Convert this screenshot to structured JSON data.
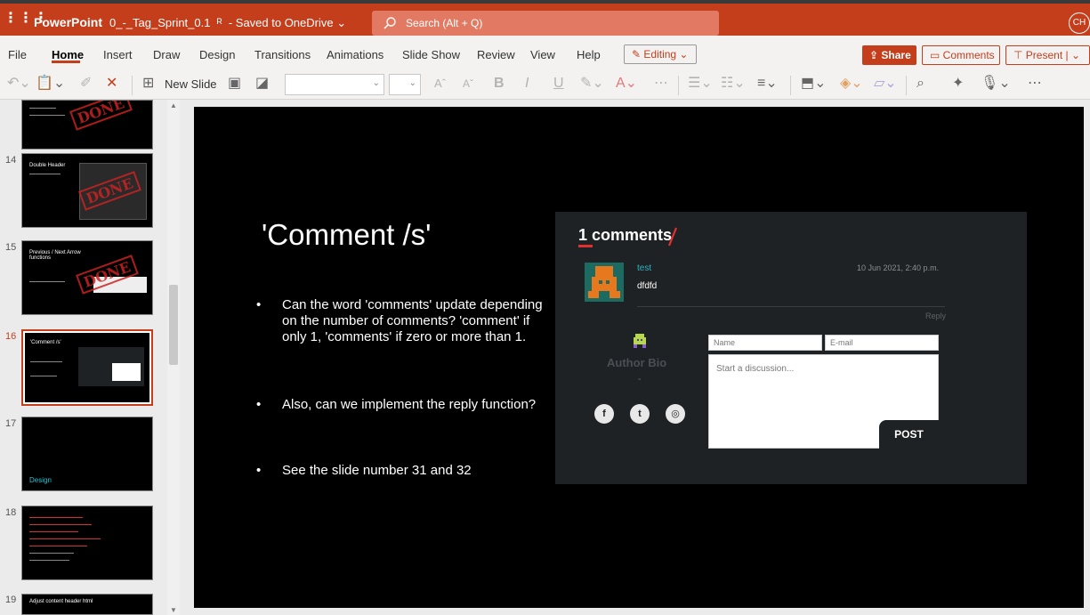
{
  "app": {
    "name": "PowerPoint",
    "document_title": "0_-_Tag_Sprint_0.1",
    "save_status": "- Saved to OneDrive",
    "search_placeholder": "Search (Alt + Q)",
    "user_initials": "CH"
  },
  "ribbon": {
    "tabs": [
      "File",
      "Home",
      "Insert",
      "Draw",
      "Design",
      "Transitions",
      "Animations",
      "Slide Show",
      "Review",
      "View",
      "Help"
    ],
    "active_tab": "Home",
    "editing_label": "Editing",
    "share_label": "Share",
    "comments_label": "Comments",
    "present_label": "Present",
    "new_slide_label": "New Slide"
  },
  "thumbnails": [
    {
      "num": "",
      "title": "",
      "stamp": "DONE"
    },
    {
      "num": "14",
      "title": "Double Header",
      "stamp": "DONE"
    },
    {
      "num": "15",
      "title": "Previous / Next Arrow functions",
      "stamp": "DONE"
    },
    {
      "num": "16",
      "title": "'Comment /s'",
      "selected": true
    },
    {
      "num": "17",
      "title": "Design"
    },
    {
      "num": "18",
      "title": ""
    },
    {
      "num": "19",
      "title": "Adjust content header html"
    }
  ],
  "slide": {
    "title": "'Comment /s'",
    "bullets": [
      "Can the word 'comments' update depending on the number of comments? 'comment' if only 1, 'comments' if zero or more than 1.",
      "Also, can we implement the reply function?",
      "See the slide number 31 and 32"
    ],
    "widget": {
      "count_label": "1 comments",
      "comment": {
        "user": "test",
        "text": "dfdfd",
        "date": "10 Jun 2021, 2:40 p.m.",
        "reply_label": "Reply"
      },
      "author_bio_label": "Author Bio",
      "author_bio_value": "-",
      "social_icons": [
        "facebook-icon",
        "twitter-icon",
        "instagram-icon"
      ],
      "name_placeholder": "Name",
      "email_placeholder": "E-mail",
      "message_placeholder": "Start a discussion...",
      "post_label": "POST"
    }
  },
  "colors": {
    "brand": "#c43e1c",
    "slide_bg": "#000000",
    "widget_bg": "#1f2224",
    "username": "#2bb3c0",
    "accent_red": "#e03030"
  }
}
